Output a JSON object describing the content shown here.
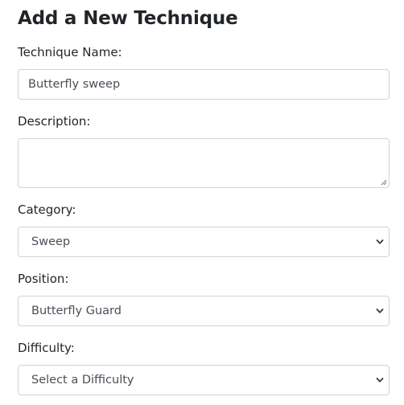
{
  "form": {
    "title": "Add a New Technique",
    "technique_name": {
      "label": "Technique Name:",
      "value": "Butterfly sweep"
    },
    "description": {
      "label": "Description:",
      "value": ""
    },
    "category": {
      "label": "Category:",
      "selected": "Sweep"
    },
    "position": {
      "label": "Position:",
      "selected": "Butterfly Guard"
    },
    "difficulty": {
      "label": "Difficulty:",
      "selected": "Select a Difficulty"
    }
  },
  "icons": {
    "dropdown": "chevron-down-icon",
    "resize": "resize-grip-icon"
  }
}
